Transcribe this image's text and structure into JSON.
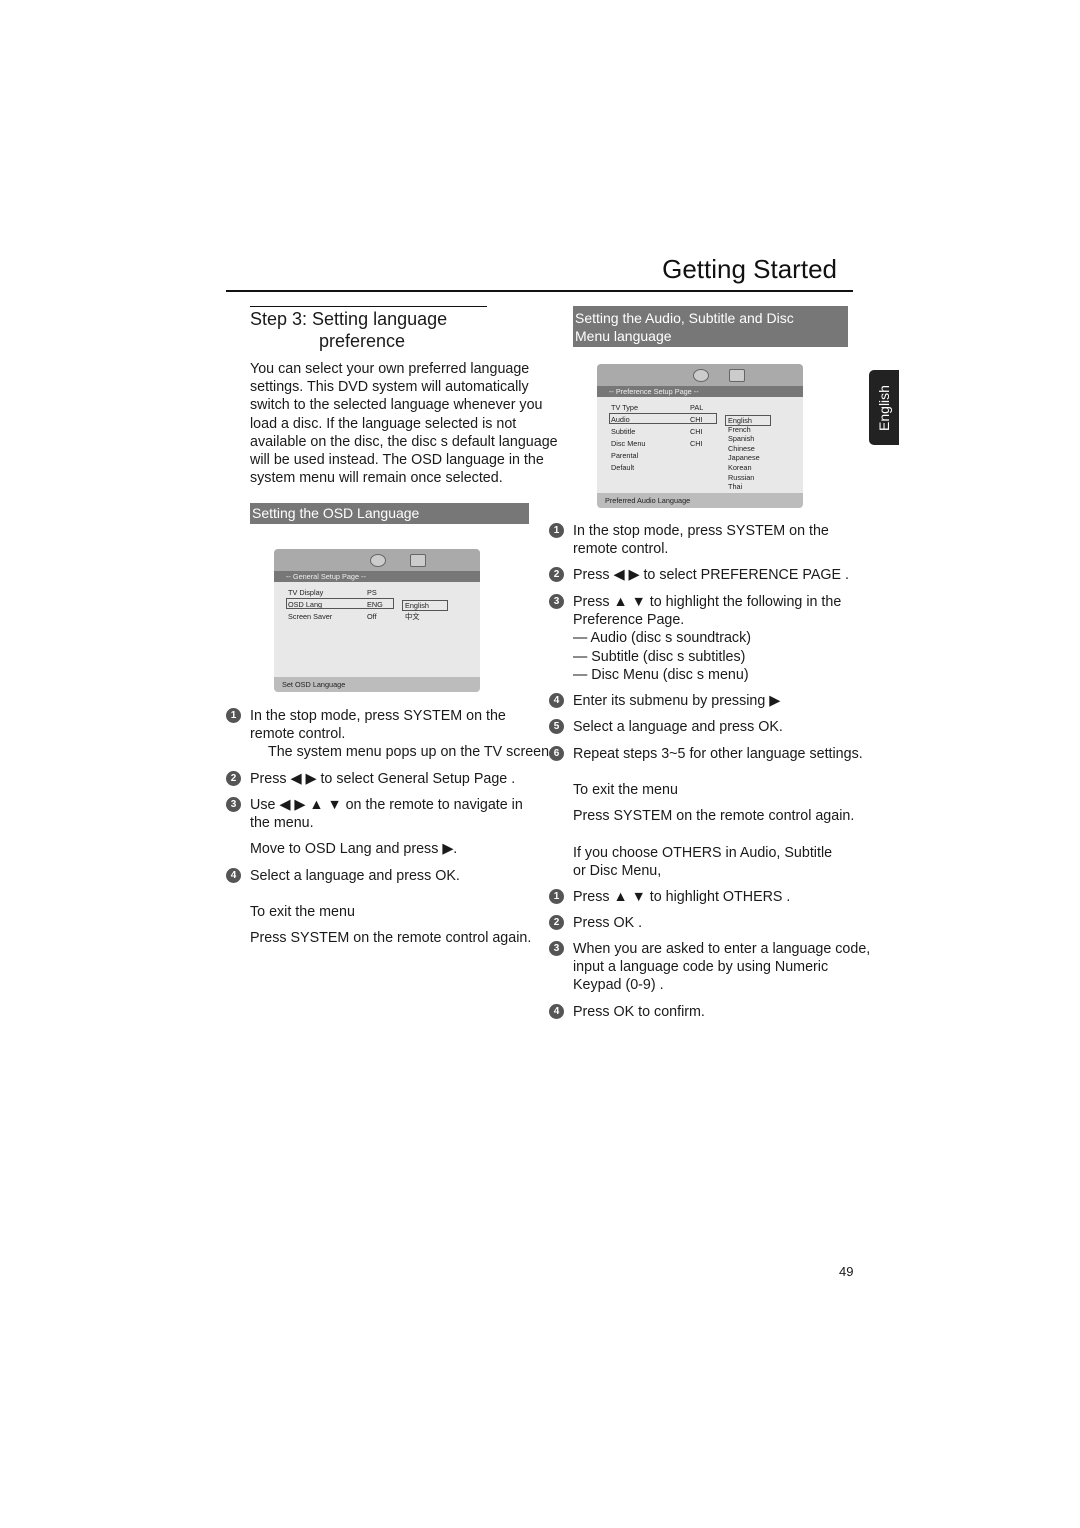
{
  "header": {
    "title": "Getting Started"
  },
  "side_tab": "English",
  "page_number": "49",
  "left": {
    "heading_line1": "Step 3:  Setting language",
    "heading_line2": "preference",
    "intro": [
      "You can select your own preferred language",
      "settings. This DVD system will automatically",
      "switch to the selected language whenever you",
      "load a disc. If the language selected is not",
      "available on the disc, the disc s default language",
      "will be used instead. The OSD language in the",
      "system menu will remain once selected."
    ],
    "section_title": "Setting the OSD Language",
    "menu": {
      "page": "-- General Setup Page --",
      "rows": [
        [
          "TV Display",
          "PS"
        ],
        [
          "OSD Lang",
          "ENG"
        ],
        [
          "Screen Saver",
          "Off"
        ]
      ],
      "options": [
        "English",
        "中文"
      ],
      "footer": "Set OSD Language"
    },
    "steps": [
      {
        "n": "1",
        "lines": [
          "In the stop mode, press SYSTEM on the",
          "remote control."
        ]
      },
      {
        "n": "",
        "lines": [
          "The system menu pops up on the TV screen."
        ]
      },
      {
        "n": "2",
        "lines": [
          "Press ◀ ▶ to select General Setup Page ."
        ]
      },
      {
        "n": "3",
        "lines": [
          "Use ◀ ▶ ▲ ▼ on the remote to navigate in",
          "the menu."
        ]
      },
      {
        "n": "",
        "lines": [
          "Move to OSD Lang  and press ▶."
        ]
      },
      {
        "n": "4",
        "lines": [
          "Select a language and press OK."
        ]
      },
      {
        "n": "",
        "lines": [
          "To exit the menu"
        ]
      },
      {
        "n": "",
        "lines": [
          "Press SYSTEM on the remote control again."
        ]
      }
    ]
  },
  "right": {
    "section_title_line1": "Setting the Audio, Subtitle and Disc",
    "section_title_line2": "Menu language",
    "menu": {
      "page": "-- Preference Setup Page --",
      "rows": [
        [
          "TV Type",
          "PAL"
        ],
        [
          "Audio",
          "CHI"
        ],
        [
          "Subtitle",
          "CHI"
        ],
        [
          "Disc Menu",
          "CHI"
        ],
        [
          "Parental",
          ""
        ],
        [
          "Default",
          ""
        ]
      ],
      "options": [
        "English",
        "French",
        "Spanish",
        "Chinese",
        "Japanese",
        "Korean",
        "Russian",
        "Thai"
      ],
      "footer": "Preferred Audio Language"
    },
    "steps": [
      {
        "n": "1",
        "lines": [
          "In the stop mode, press SYSTEM on the",
          "remote control."
        ]
      },
      {
        "n": "2",
        "lines": [
          "Press ◀ ▶ to select  PREFERENCE PAGE ."
        ]
      },
      {
        "n": "3",
        "lines": [
          "Press ▲ ▼ to highlight the following in the",
          "Preference Page.",
          "— Audio  (disc s soundtrack)",
          "— Subtitle  (disc s subtitles)",
          "— Disc Menu  (disc s menu)"
        ]
      },
      {
        "n": "4",
        "lines": [
          "Enter its submenu by pressing ▶"
        ]
      },
      {
        "n": "5",
        "lines": [
          "Select a language and press OK."
        ]
      },
      {
        "n": "6",
        "lines": [
          "Repeat steps 3~5 for other language settings."
        ]
      },
      {
        "n": "",
        "lines": [
          "To exit the menu"
        ]
      },
      {
        "n": "",
        "lines": [
          "Press SYSTEM on the remote control again."
        ]
      },
      {
        "n": "",
        "lines": [
          "If you choose OTHERS in Audio, Subtitle",
          "or Disc Menu,"
        ]
      },
      {
        "n": "1",
        "lines": [
          "Press ▲ ▼ to highlight  OTHERS ."
        ]
      },
      {
        "n": "2",
        "lines": [
          "Press OK ."
        ]
      },
      {
        "n": "3",
        "lines": [
          "When you are asked to enter a language code,",
          "input a language code by using Numeric",
          "Keypad (0-9) ."
        ]
      },
      {
        "n": "4",
        "lines": [
          "Press OK  to confirm."
        ]
      }
    ]
  }
}
